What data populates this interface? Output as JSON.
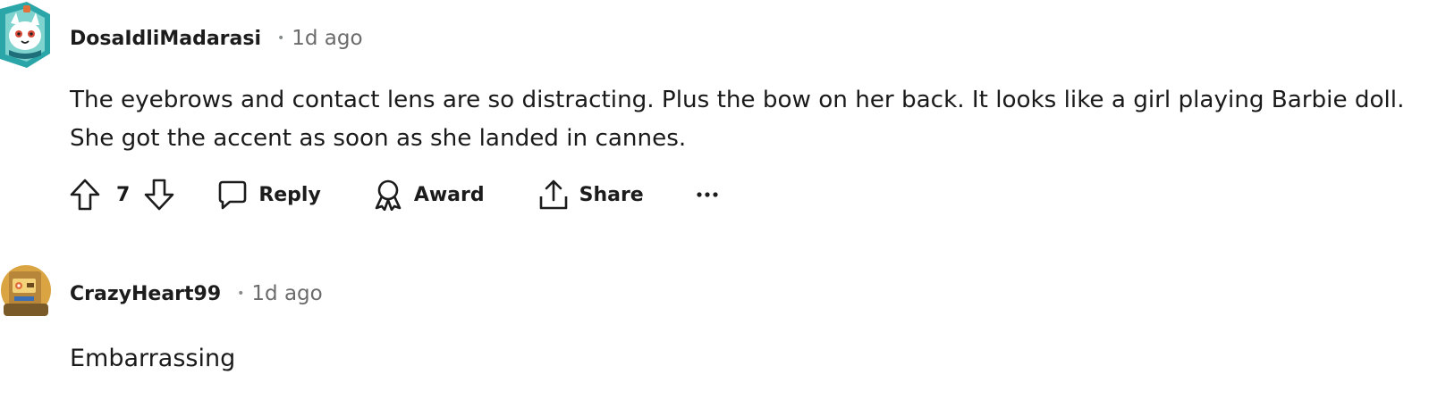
{
  "comments": [
    {
      "username": "DosaIdliMadarasi",
      "separator": "•",
      "time": "1d ago",
      "body_lines": [
        "The eyebrows and contact lens are so distracting. Plus the bow on her back. It looks like a girl playing Barbie doll.",
        "She got the accent as soon as she landed in cannes."
      ],
      "votes": "7",
      "actions": {
        "reply": "Reply",
        "award": "Award",
        "share": "Share",
        "more": "•••"
      },
      "avatar_icon": "snow-creature-avatar-icon"
    },
    {
      "username": "CrazyHeart99",
      "separator": "•",
      "time": "1d ago",
      "body_lines": [
        "Embarrassing"
      ],
      "avatar_icon": "robot-avatar-icon"
    }
  ],
  "icons": {
    "upvote": "arrow-up-outline-icon",
    "downvote": "arrow-down-outline-icon",
    "reply": "speech-bubble-icon",
    "award": "ribbon-award-icon",
    "share": "upload-share-icon",
    "more": "ellipsis-icon"
  },
  "colors": {
    "text": "#1a1a1b",
    "meta": "#6b6b6b",
    "avatar1_bg": "#2aa6a8",
    "avatar2_bg": "#d9a441"
  }
}
